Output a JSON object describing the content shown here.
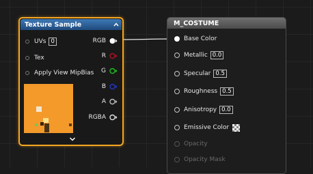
{
  "texture_node": {
    "title": "Texture Sample",
    "inputs": [
      {
        "label": "UVs",
        "value": "0"
      },
      {
        "label": "Tex"
      },
      {
        "label": "Apply View MipBias"
      }
    ],
    "outputs": [
      {
        "label": "RGB",
        "pin_color": "#ffffff"
      },
      {
        "label": "R",
        "pin_color": "#b01025"
      },
      {
        "label": "G",
        "pin_color": "#1fc01f"
      },
      {
        "label": "B",
        "pin_color": "#2436c8"
      },
      {
        "label": "A",
        "pin_color": "#bdbdbd"
      },
      {
        "label": "RGBA",
        "pin_color": "#e0e0e0"
      }
    ],
    "preview_color": "#f39a2b",
    "header_color": "#2d5f97",
    "selected_border": "#f5a623"
  },
  "material_node": {
    "title": "M_COSTUME",
    "inputs": [
      {
        "label": "Base Color"
      },
      {
        "label": "Metallic",
        "value": "0.0"
      },
      {
        "label": "Specular",
        "value": "0.5"
      },
      {
        "label": "Roughness",
        "value": "0.5"
      },
      {
        "label": "Anisotropy",
        "value": "0.0"
      },
      {
        "label": "Emissive Color"
      },
      {
        "label": "Opacity"
      },
      {
        "label": "Opacity Mask"
      }
    ]
  }
}
